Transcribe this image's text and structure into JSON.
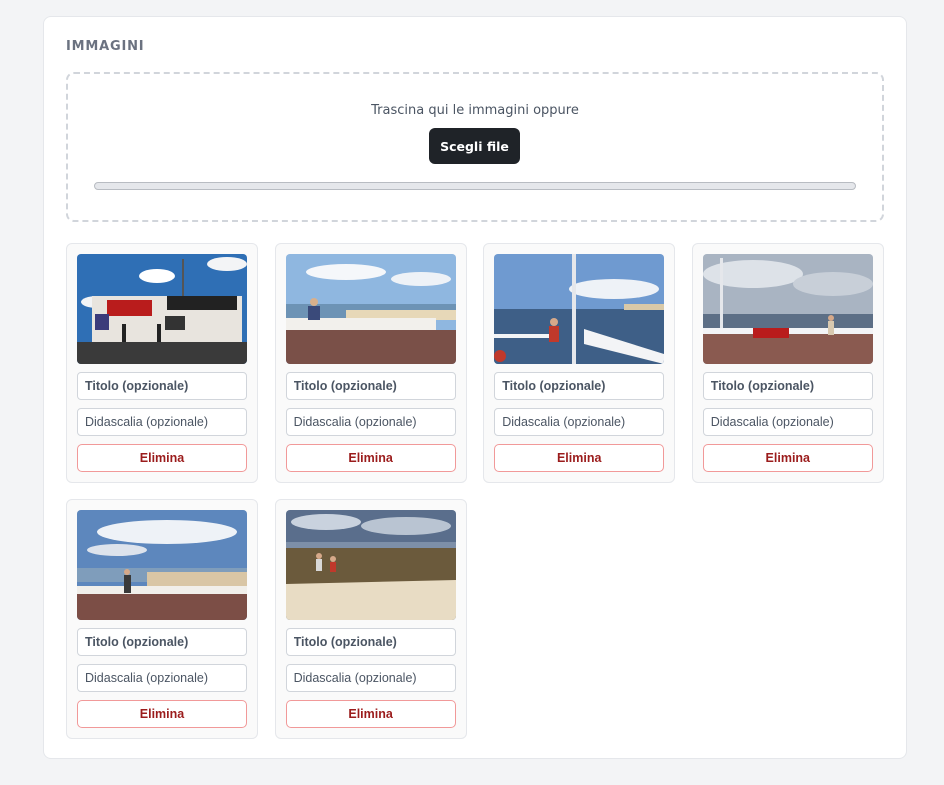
{
  "section": {
    "title": "IMMAGINI"
  },
  "dropzone": {
    "text": "Trascina qui le immagini oppure",
    "button_label": "Scegli file",
    "progress": 0
  },
  "colors": {
    "accent_dark": "#1f2328",
    "danger": "#9b1c1c",
    "danger_border": "#f19999"
  },
  "images": [
    {
      "title_placeholder": "Titolo (opzionale)",
      "caption_placeholder": "Didascalia (opzionale)",
      "delete_label": "Elimina"
    },
    {
      "title_placeholder": "Titolo (opzionale)",
      "caption_placeholder": "Didascalia (opzionale)",
      "delete_label": "Elimina"
    },
    {
      "title_placeholder": "Titolo (opzionale)",
      "caption_placeholder": "Didascalia (opzionale)",
      "delete_label": "Elimina"
    },
    {
      "title_placeholder": "Titolo (opzionale)",
      "caption_placeholder": "Didascalia (opzionale)",
      "delete_label": "Elimina"
    },
    {
      "title_placeholder": "Titolo (opzionale)",
      "caption_placeholder": "Didascalia (opzionale)",
      "delete_label": "Elimina"
    },
    {
      "title_placeholder": "Titolo (opzionale)",
      "caption_placeholder": "Didascalia (opzionale)",
      "delete_label": "Elimina"
    }
  ]
}
